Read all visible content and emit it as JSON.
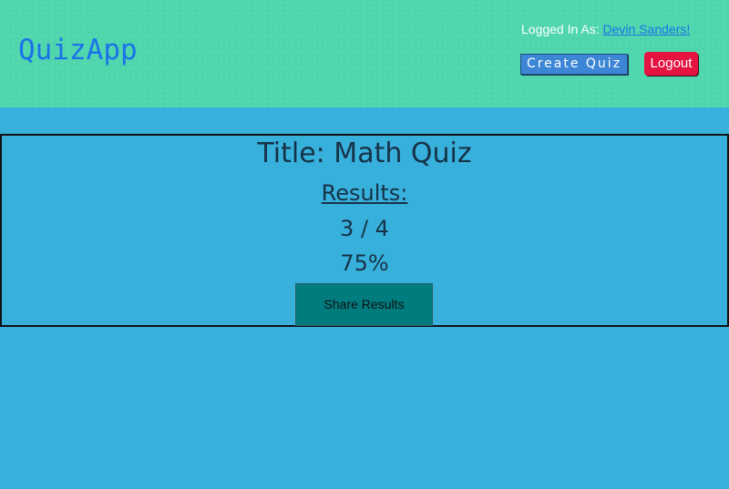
{
  "header": {
    "logo": "QuizApp",
    "logged_in_prefix": "Logged In As: ",
    "user_name": "Devin Sanders!",
    "create_quiz_label": "Create Quiz",
    "logout_label": "Logout"
  },
  "results": {
    "title": "Title: Math Quiz",
    "heading": "Results:",
    "score": "3 / 4",
    "percent": "75%",
    "share_label": "Share Results"
  },
  "colors": {
    "header_bg": "#4fd6ad",
    "page_bg": "#38b0dc",
    "logo": "#1a73e8",
    "create_button": "#3d86d6",
    "logout_button": "#e4133f",
    "share_button": "#007b7e"
  }
}
